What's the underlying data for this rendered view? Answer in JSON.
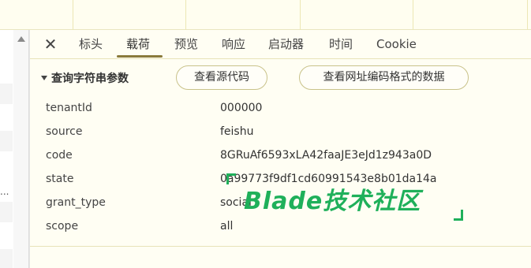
{
  "tabs": {
    "close_glyph": "✕",
    "items": [
      {
        "label": "标头"
      },
      {
        "label": "载荷"
      },
      {
        "label": "预览"
      },
      {
        "label": "响应"
      },
      {
        "label": "启动器"
      },
      {
        "label": "时间"
      },
      {
        "label": "Cookie"
      }
    ],
    "active": "载荷"
  },
  "section": {
    "title": "查询字符串参数",
    "view_source_label": "查看源代码",
    "view_url_encoded_label": "查看网址编码格式的数据"
  },
  "params": [
    {
      "key": "tenantId",
      "value": "000000"
    },
    {
      "key": "source",
      "value": "feishu"
    },
    {
      "key": "code",
      "value": "8GRuAf6593xLA42faaJE3eJd1z943a0D"
    },
    {
      "key": "state",
      "value": "0a99773f9df1cd60991543e8b01da14a"
    },
    {
      "key": "grant_type",
      "value": "social"
    },
    {
      "key": "scope",
      "value": "all"
    }
  ],
  "left_pane": {
    "overflow_text": "..."
  },
  "watermark": {
    "text": "Blade技术社区"
  },
  "colors": {
    "panel_bg": "#fffef3",
    "active_underline": "#8a7a3a",
    "pill_border": "#c9c28a",
    "watermark": "#1fb05a"
  }
}
